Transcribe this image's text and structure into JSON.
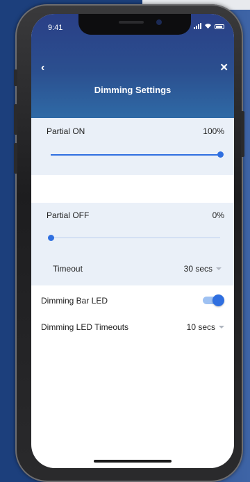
{
  "status_bar": {
    "time": "9:41"
  },
  "header": {
    "title": "Dimming Settings",
    "back_icon": "chevron-left-icon",
    "close_icon": "close-icon"
  },
  "partial_on": {
    "label": "Partial ON",
    "value": "100%",
    "level": 1.0
  },
  "partial_off": {
    "label": "Partial OFF",
    "value": "0%",
    "level": 0.0
  },
  "timeout": {
    "label": "Timeout",
    "value": "30 secs"
  },
  "dimming_bar_led": {
    "label": "Dimming Bar LED",
    "enabled": true
  },
  "dimming_led_timeouts": {
    "label": "Dimming LED Timeouts",
    "value": "10 secs"
  },
  "colors": {
    "accent": "#2f6fe0",
    "header": "#2b4f8f",
    "section_bg": "#eaf0f8"
  }
}
